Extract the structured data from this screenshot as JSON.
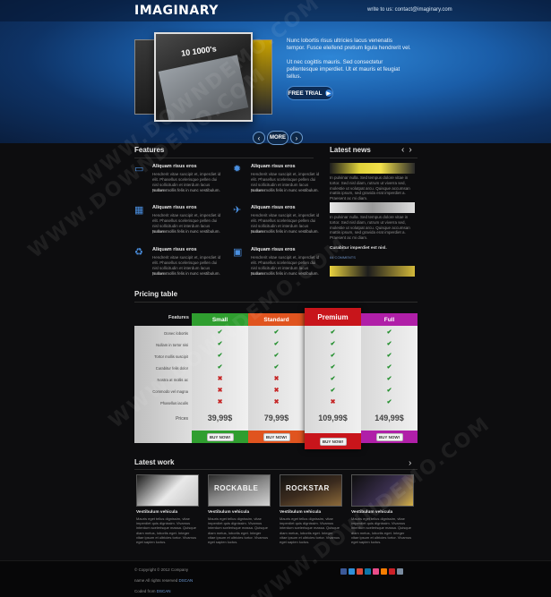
{
  "header": {
    "logo": "IMAGINARY",
    "contact": "write to us: contact@imaginary.com"
  },
  "hero": {
    "slide_title": "10 1000's",
    "paragraph1": "Nunc lobortis risus ultricies lacus venenatis tempor. Fusce eleifend pretium ligula hendrerit vel.",
    "paragraph2": "Ut nec cogittis mauris. Sed consectetur pellentesque imperdiet. Ut et mauris et feugiat tellus.",
    "cta_label": "FREE TRIAL",
    "more_label": "MORE"
  },
  "features": {
    "title": "Features",
    "items": [
      {
        "icon": "monitor-icon",
        "title": "Aliquam risus eros",
        "body": "Hendrerit vitae suscipit et, imperdiet id elit. Phasellus scelerisque pellen dui nisl sollicitudin et interdum lacus posuere.",
        "link": "Nullam mollis felis in nunc vestibulum."
      },
      {
        "icon": "gear-icon",
        "title": "Aliquam risus eros",
        "body": "Hendrerit vitae suscipit et, imperdiet id elit. Phasellus scelerisque pellen dui nisl sollicitudin et interdum lacus posuere.",
        "link": "Nullam mollis felis in nunc vestibulum."
      },
      {
        "icon": "calendar-icon",
        "title": "Aliquam risus eros",
        "body": "Hendrerit vitae suscipit et, imperdiet id elit. Phasellus scelerisque pellen dui nisl sollicitudin et interdum lacus posuere.",
        "link": "Nullam mollis felis in nunc vestibulum."
      },
      {
        "icon": "plane-icon",
        "title": "Aliquam risus eros",
        "body": "Hendrerit vitae suscipit et, imperdiet id elit. Phasellus scelerisque pellen dui nisl sollicitudin et interdum lacus posuere.",
        "link": "Nullam mollis felis in nunc vestibulum."
      },
      {
        "icon": "recycle-icon",
        "title": "Aliquam risus eros",
        "body": "Hendrerit vitae suscipit et, imperdiet id elit. Phasellus scelerisque pellen dui nisl sollicitudin et interdum lacus posuere.",
        "link": "Nullam mollis felis in nunc vestibulum."
      },
      {
        "icon": "box-icon",
        "title": "Aliquam risus eros",
        "body": "Hendrerit vitae suscipit et, imperdiet id elit. Phasellus scelerisque pellen dui nisl sollicitudin et interdum lacus posuere.",
        "link": "Nullam mollis felis in nunc vestibulum."
      }
    ]
  },
  "news": {
    "title": "Latest news",
    "items": [
      {
        "text": "In pulvinar nulla. Sed tempus dolore vitae in tortor. Sed nisl diam, rutrum ut viverra sed, molestie ut volutpat arcu. Quisque accumsan mattis ipsum, sed gravida erat imperdiet a. Praesent ac mi diam."
      },
      {
        "text": "In pulvinar nulla. Sed tempus dolore vitae in tortor. Sed nisl diam, rutrum ut viverra sed, molestie ut volutpat arcu. Quisque accumsan mattis ipsum, sed gravida erat imperdiet a. Praesent ac mi diam."
      }
    ],
    "caption": "Curabitur imperdiet est nisl.",
    "meta": "64 COMMENTS"
  },
  "pricing": {
    "title": "Pricing table",
    "features_label": "Features",
    "rows": [
      "Donec lobortis",
      "Nullam in tortor nisi",
      "Tortor mollis suscipit",
      "Curabitur felis dolor",
      "Nostra at mollis ac",
      "Commodo vel magna",
      "Phasellus iaculis"
    ],
    "prices_label": "Prices",
    "plans": [
      {
        "name": "Small",
        "price": "39,99$",
        "button": "BUY NOW!",
        "color": "#2f9e2f",
        "checks": [
          true,
          true,
          true,
          true,
          false,
          false,
          false
        ]
      },
      {
        "name": "Standard",
        "price": "79,99$",
        "button": "BUY NOW!",
        "color": "#e0541f",
        "checks": [
          true,
          true,
          true,
          true,
          false,
          false,
          false
        ]
      },
      {
        "name": "Premium",
        "price": "109,99$",
        "button": "BUY NOW!",
        "color": "#c8151b",
        "checks": [
          true,
          true,
          true,
          true,
          true,
          true,
          false
        ]
      },
      {
        "name": "Full",
        "price": "149,99$",
        "button": "BUY NOW!",
        "color": "#b01fa8",
        "checks": [
          true,
          true,
          true,
          true,
          true,
          true,
          true
        ]
      }
    ]
  },
  "work": {
    "title": "Latest work",
    "items": [
      {
        "tag": "",
        "title": "Vestibulum vehicula",
        "text": "Mauris eget tellus dignissim, vitae imperdiet quis dignissim. Vivamus interdum scelerisque massa. Quisque diam metus, lobortis eget. Integer vitae ipsum et ultricies tortor. Vivamus eget sapien luctus."
      },
      {
        "tag": "ROCKABLE",
        "title": "Vestibulum vehicula",
        "text": "Mauris eget tellus dignissim, vitae imperdiet quis dignissim. Vivamus interdum scelerisque massa. Quisque diam metus, lobortis eget. Integer vitae ipsum et ultricies tortor. Vivamus eget sapien luctus."
      },
      {
        "tag": "ROCKSTAR",
        "title": "Vestibulum vehicula",
        "text": "Mauris eget tellus dignissim, vitae imperdiet quis dignissim. Vivamus interdum scelerisque massa. Quisque diam metus, lobortis eget. Integer vitae ipsum et ultricies tortor. Vivamus eget sapien luctus."
      },
      {
        "tag": "",
        "title": "Vestibulum vehicula",
        "text": "Mauris eget tellus dignissim, vitae imperdiet quis dignissim. Vivamus interdum scelerisque massa. Quisque diam metus, lobortis eget. Integer vitae ipsum et ultricies tortor. Vivamus eget sapien luctus."
      }
    ]
  },
  "footer": {
    "copyright": "© Copyright © 2012 Company",
    "rights": "name All rights reserved",
    "rights_link": "DSCAN",
    "credit": "Coded from",
    "credit_link": "DSCAN"
  },
  "watermark": "WWW.DOWNDEMO.COM",
  "colors": {
    "accent_blue": "#2f7ad0",
    "check_green": "#1f8e2a",
    "cross_red": "#c62828"
  }
}
